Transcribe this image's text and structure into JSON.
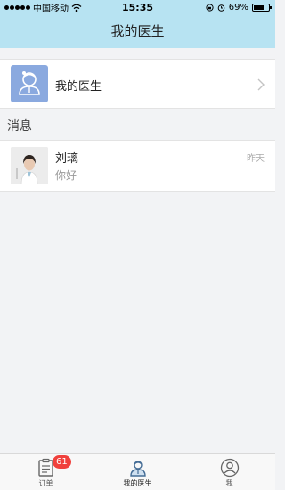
{
  "status_bar": {
    "carrier": "中国移动",
    "time": "15:35",
    "battery": "69%",
    "battery_level": 0.69
  },
  "header": {
    "title": "我的医生"
  },
  "my_doctor_row": {
    "label": "我的医生",
    "icon": "doctor-icon"
  },
  "messages_section": {
    "title": "消息",
    "items": [
      {
        "name": "刘璃",
        "preview": "你好",
        "time": "昨天"
      }
    ]
  },
  "tab_bar": {
    "tabs": [
      {
        "label": "订单",
        "icon": "order-icon",
        "badge": "61"
      },
      {
        "label": "我的医生",
        "icon": "doctor-icon",
        "active": true
      },
      {
        "label": "我",
        "icon": "profile-icon"
      }
    ]
  },
  "colors": {
    "header_bg": "#b7e3f2",
    "avatar_bg": "#8aa9df",
    "badge_red": "#f0403c"
  }
}
